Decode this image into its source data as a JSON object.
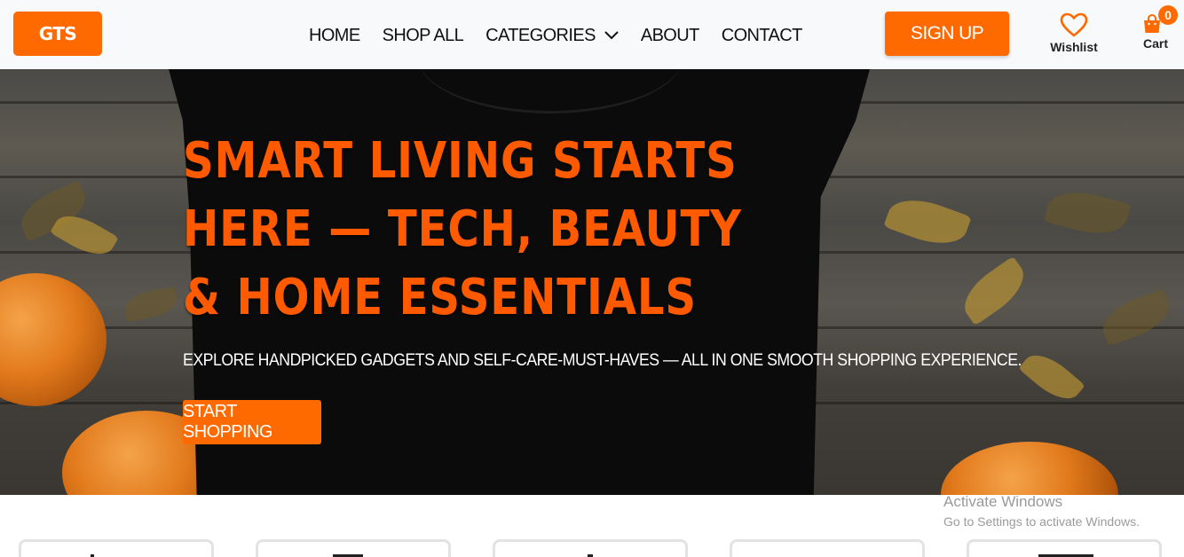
{
  "header": {
    "logo": "GTS",
    "nav": [
      {
        "label": "HOME"
      },
      {
        "label": "SHOP ALL"
      },
      {
        "label": "CATEGORIES",
        "icon": "chevron-down-icon"
      },
      {
        "label": "ABOUT"
      },
      {
        "label": "CONTACT"
      }
    ],
    "signup_label": "SIGN UP",
    "wishlist_label": "Wishlist",
    "cart_label": "Cart",
    "cart_count": "0"
  },
  "hero": {
    "title": "SMART LIVING STARTS HERE — TECH, BEAUTY & HOME ESSENTIALS",
    "subtitle": "EXPLORE HANDPICKED GADGETS AND SELF-CARE-MUST-HAVES — ALL IN ONE SMOOTH SHOPPING EXPERIENCE.",
    "cta_label": "START SHOPPING"
  },
  "watermark": {
    "line1": "Activate Windows",
    "line2": "Go to Settings to activate Windows."
  },
  "colors": {
    "accent": "#ff6a00",
    "title": "#ff5a00",
    "header_bg": "#f8f9fb"
  }
}
